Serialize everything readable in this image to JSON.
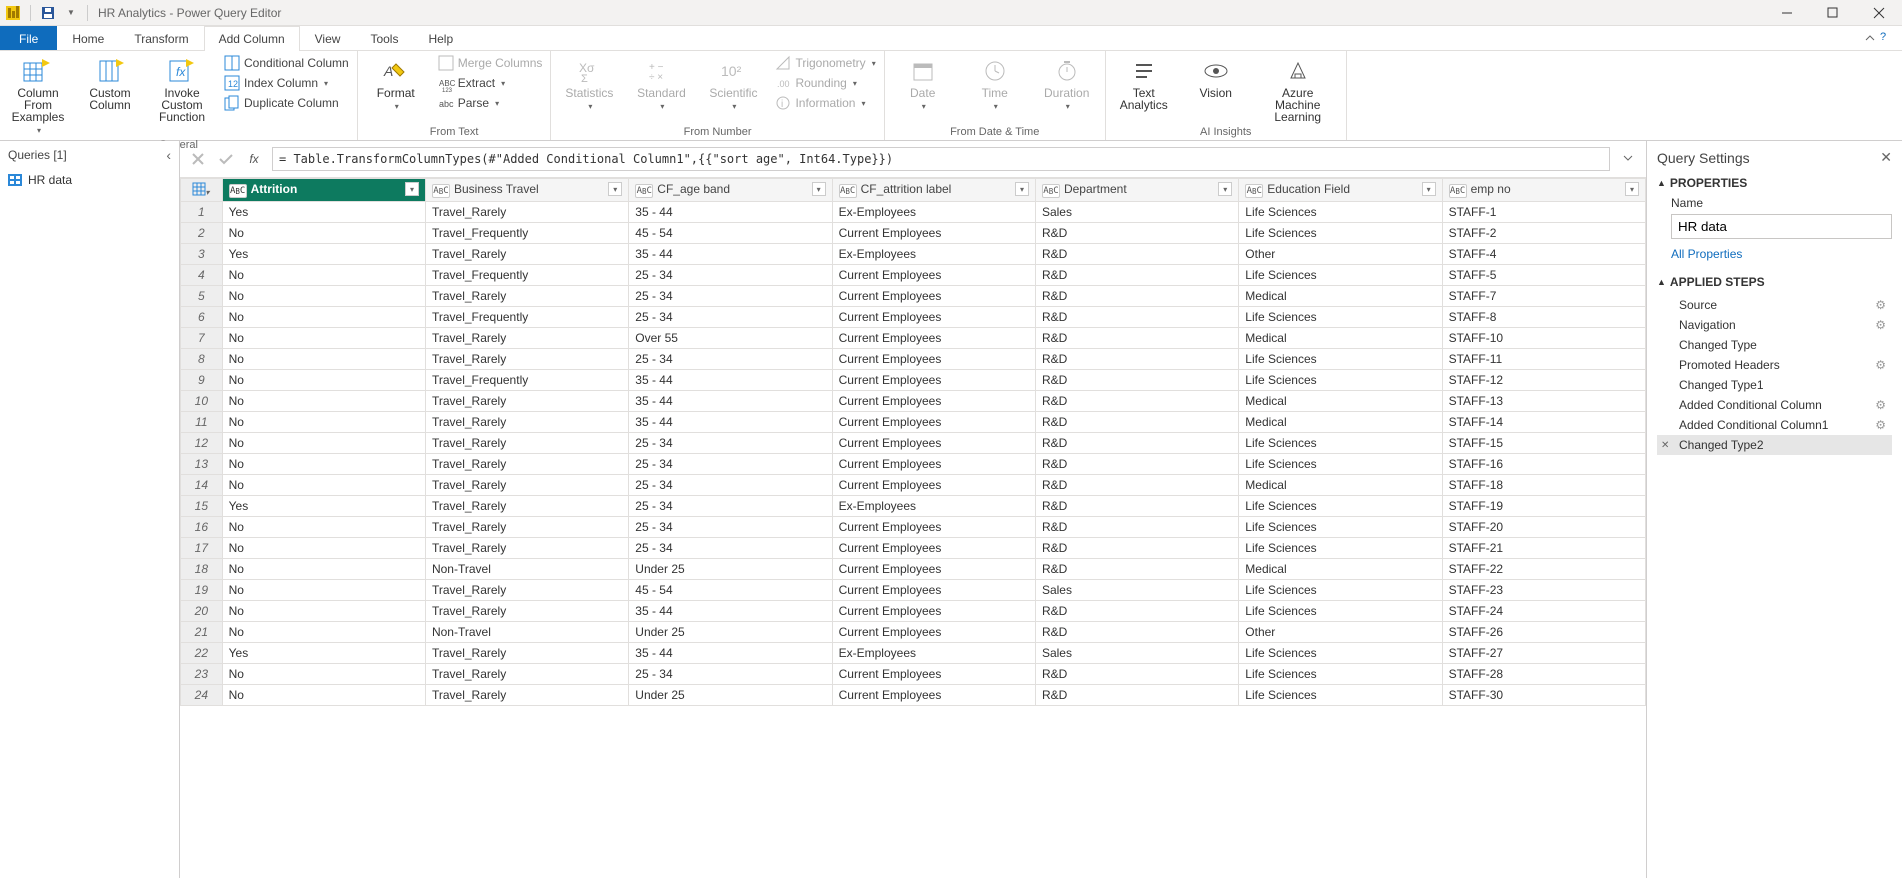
{
  "title_bar": {
    "title": "HR Analytics - Power Query Editor"
  },
  "tabs": {
    "file": "File",
    "home": "Home",
    "transform": "Transform",
    "add_column": "Add Column",
    "view": "View",
    "tools": "Tools",
    "help": "Help"
  },
  "ribbon": {
    "general": {
      "column_from_examples": "Column From Examples",
      "custom_column": "Custom Column",
      "invoke_custom_function": "Invoke Custom Function",
      "conditional_column": "Conditional Column",
      "index_column": "Index Column",
      "duplicate_column": "Duplicate Column",
      "label": "General"
    },
    "from_text": {
      "format": "Format",
      "merge_columns": "Merge Columns",
      "extract": "Extract",
      "parse": "Parse",
      "label": "From Text"
    },
    "from_number": {
      "statistics": "Statistics",
      "standard": "Standard",
      "scientific": "Scientific",
      "trigonometry": "Trigonometry",
      "rounding": "Rounding",
      "information": "Information",
      "label": "From Number"
    },
    "from_date_time": {
      "date": "Date",
      "time": "Time",
      "duration": "Duration",
      "label": "From Date & Time"
    },
    "ai_insights": {
      "text_analytics": "Text Analytics",
      "vision": "Vision",
      "azure_ml": "Azure Machine Learning",
      "label": "AI Insights"
    }
  },
  "queries_pane": {
    "header": "Queries [1]",
    "items": [
      "HR data"
    ]
  },
  "formula_bar": {
    "value": "= Table.TransformColumnTypes(#\"Added Conditional Column1\",{{\"sort age\", Int64.Type}})"
  },
  "grid": {
    "columns": [
      {
        "name": "Attrition",
        "type": "ABC",
        "selected": true
      },
      {
        "name": "Business Travel",
        "type": "ABC"
      },
      {
        "name": "CF_age band",
        "type": "ABC"
      },
      {
        "name": "CF_attrition label",
        "type": "ABC"
      },
      {
        "name": "Department",
        "type": "ABC"
      },
      {
        "name": "Education Field",
        "type": "ABC"
      },
      {
        "name": "emp no",
        "type": "ABC"
      }
    ],
    "rows": [
      [
        "Yes",
        "Travel_Rarely",
        "35 - 44",
        "Ex-Employees",
        "Sales",
        "Life Sciences",
        "STAFF-1"
      ],
      [
        "No",
        "Travel_Frequently",
        "45 - 54",
        "Current Employees",
        "R&D",
        "Life Sciences",
        "STAFF-2"
      ],
      [
        "Yes",
        "Travel_Rarely",
        "35 - 44",
        "Ex-Employees",
        "R&D",
        "Other",
        "STAFF-4"
      ],
      [
        "No",
        "Travel_Frequently",
        "25 - 34",
        "Current Employees",
        "R&D",
        "Life Sciences",
        "STAFF-5"
      ],
      [
        "No",
        "Travel_Rarely",
        "25 - 34",
        "Current Employees",
        "R&D",
        "Medical",
        "STAFF-7"
      ],
      [
        "No",
        "Travel_Frequently",
        "25 - 34",
        "Current Employees",
        "R&D",
        "Life Sciences",
        "STAFF-8"
      ],
      [
        "No",
        "Travel_Rarely",
        "Over 55",
        "Current Employees",
        "R&D",
        "Medical",
        "STAFF-10"
      ],
      [
        "No",
        "Travel_Rarely",
        "25 - 34",
        "Current Employees",
        "R&D",
        "Life Sciences",
        "STAFF-11"
      ],
      [
        "No",
        "Travel_Frequently",
        "35 - 44",
        "Current Employees",
        "R&D",
        "Life Sciences",
        "STAFF-12"
      ],
      [
        "No",
        "Travel_Rarely",
        "35 - 44",
        "Current Employees",
        "R&D",
        "Medical",
        "STAFF-13"
      ],
      [
        "No",
        "Travel_Rarely",
        "35 - 44",
        "Current Employees",
        "R&D",
        "Medical",
        "STAFF-14"
      ],
      [
        "No",
        "Travel_Rarely",
        "25 - 34",
        "Current Employees",
        "R&D",
        "Life Sciences",
        "STAFF-15"
      ],
      [
        "No",
        "Travel_Rarely",
        "25 - 34",
        "Current Employees",
        "R&D",
        "Life Sciences",
        "STAFF-16"
      ],
      [
        "No",
        "Travel_Rarely",
        "25 - 34",
        "Current Employees",
        "R&D",
        "Medical",
        "STAFF-18"
      ],
      [
        "Yes",
        "Travel_Rarely",
        "25 - 34",
        "Ex-Employees",
        "R&D",
        "Life Sciences",
        "STAFF-19"
      ],
      [
        "No",
        "Travel_Rarely",
        "25 - 34",
        "Current Employees",
        "R&D",
        "Life Sciences",
        "STAFF-20"
      ],
      [
        "No",
        "Travel_Rarely",
        "25 - 34",
        "Current Employees",
        "R&D",
        "Life Sciences",
        "STAFF-21"
      ],
      [
        "No",
        "Non-Travel",
        "Under 25",
        "Current Employees",
        "R&D",
        "Medical",
        "STAFF-22"
      ],
      [
        "No",
        "Travel_Rarely",
        "45 - 54",
        "Current Employees",
        "Sales",
        "Life Sciences",
        "STAFF-23"
      ],
      [
        "No",
        "Travel_Rarely",
        "35 - 44",
        "Current Employees",
        "R&D",
        "Life Sciences",
        "STAFF-24"
      ],
      [
        "No",
        "Non-Travel",
        "Under 25",
        "Current Employees",
        "R&D",
        "Other",
        "STAFF-26"
      ],
      [
        "Yes",
        "Travel_Rarely",
        "35 - 44",
        "Ex-Employees",
        "Sales",
        "Life Sciences",
        "STAFF-27"
      ],
      [
        "No",
        "Travel_Rarely",
        "25 - 34",
        "Current Employees",
        "R&D",
        "Life Sciences",
        "STAFF-28"
      ],
      [
        "No",
        "Travel_Rarely",
        "Under 25",
        "Current Employees",
        "R&D",
        "Life Sciences",
        "STAFF-30"
      ]
    ]
  },
  "settings": {
    "header": "Query Settings",
    "properties_label": "PROPERTIES",
    "name_label": "Name",
    "name_value": "HR data",
    "all_properties": "All Properties",
    "applied_steps_label": "APPLIED STEPS",
    "steps": [
      {
        "label": "Source",
        "gear": true
      },
      {
        "label": "Navigation",
        "gear": true
      },
      {
        "label": "Changed Type",
        "gear": false
      },
      {
        "label": "Promoted Headers",
        "gear": true
      },
      {
        "label": "Changed Type1",
        "gear": false
      },
      {
        "label": "Added Conditional Column",
        "gear": true
      },
      {
        "label": "Added Conditional Column1",
        "gear": true
      },
      {
        "label": "Changed Type2",
        "gear": false,
        "selected": true
      }
    ]
  }
}
